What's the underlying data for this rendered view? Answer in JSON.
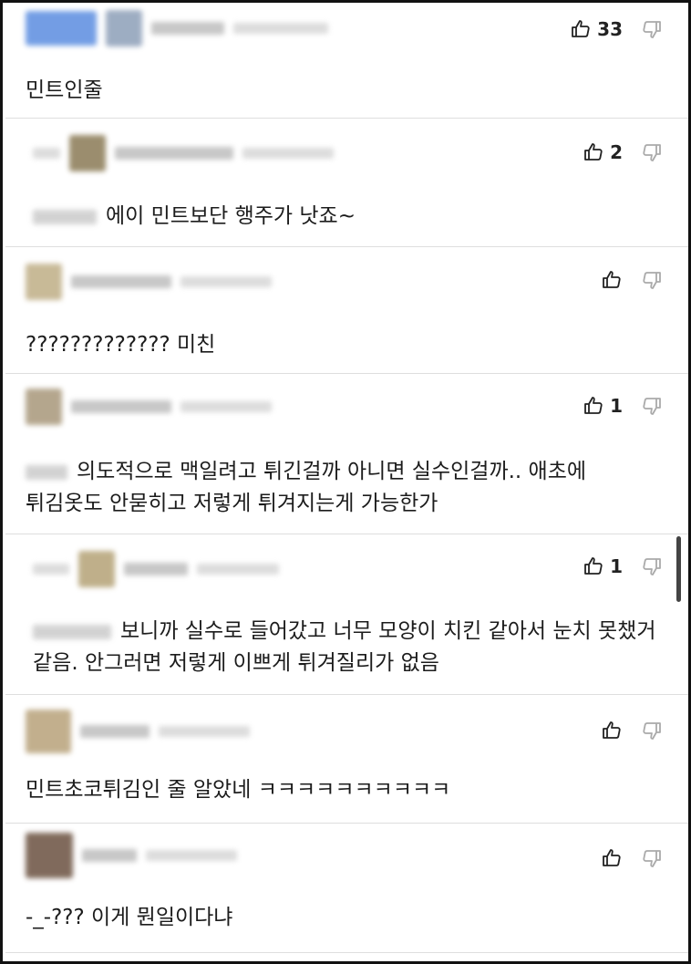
{
  "comments": [
    {
      "likes": "33",
      "text": "민트인줄"
    },
    {
      "likes": "2",
      "text": "에이 민트보단 행주가 낫죠~"
    },
    {
      "likes": "",
      "text": "????????????? 미친"
    },
    {
      "likes": "1",
      "text": "의도적으로 맥일려고 튀긴걸까 아니면 실수인걸까.. 애초에 튀김옷도 안묻히고 저렇게 튀겨지는게 가능한가"
    },
    {
      "likes": "1",
      "text": "보니까 실수로 들어갔고 너무 모양이 치킨 같아서 눈치 못챘거 같음. 안그러면 저렇게 이쁘게 튀겨질리가 없음"
    },
    {
      "likes": "",
      "text": "민트초코튀김인 줄 알았네 ㅋㅋㅋㅋㅋㅋㅋㅋㅋㅋ"
    },
    {
      "likes": "",
      "text": "-_-??? 이게 뭔일이다냐"
    }
  ],
  "icons": {
    "like": "thumbs-up-icon",
    "dislike": "thumbs-down-icon"
  }
}
